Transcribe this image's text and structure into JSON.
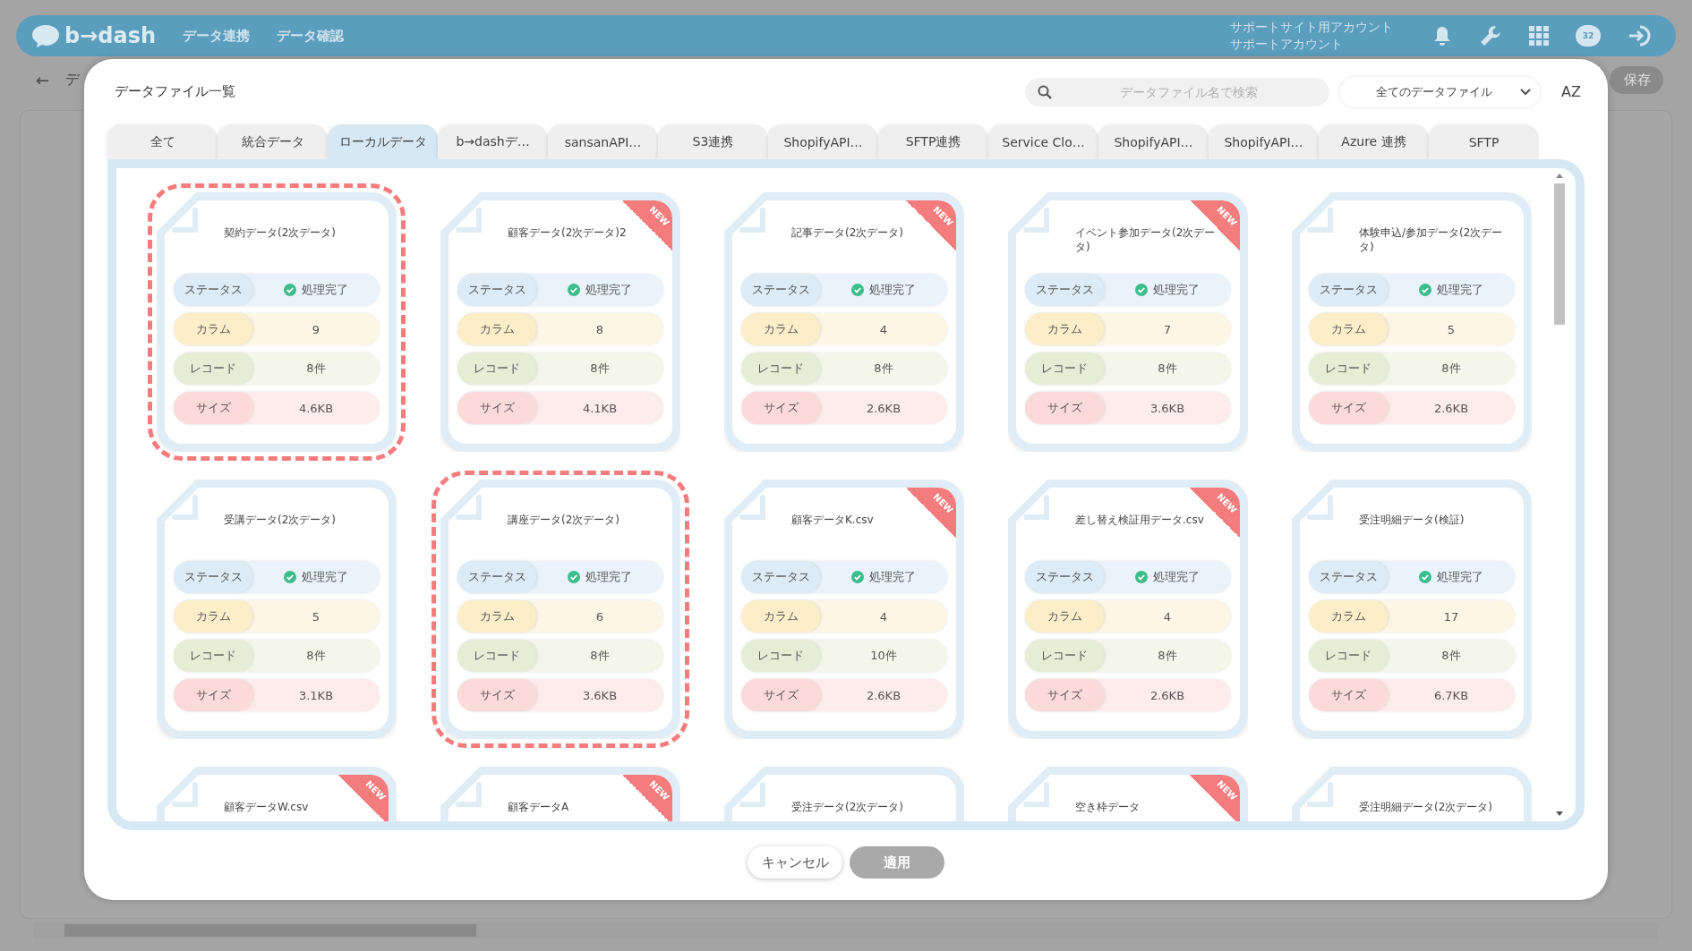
{
  "header": {
    "logo": "b→dash",
    "nav": [
      "データ連携",
      "データ確認"
    ],
    "account": [
      "サポートサイト用アカウント",
      "サポートアカウント"
    ],
    "chat_badge": "32"
  },
  "subbar": {
    "back": "←",
    "breadcrumb": "デ",
    "save": "保存"
  },
  "modal": {
    "title": "データファイル一覧",
    "search": {
      "placeholder": "データファイル名で検索"
    },
    "filter": "全てのデータファイル",
    "sort": "AZ",
    "tabs": [
      {
        "label": "全て",
        "selected": false
      },
      {
        "label": "統合データ",
        "selected": false
      },
      {
        "label": "ローカルデータ",
        "selected": true
      },
      {
        "label": "b→dashデ…",
        "selected": false
      },
      {
        "label": "sansanAPI…",
        "selected": false
      },
      {
        "label": "S3連携",
        "selected": false
      },
      {
        "label": "ShopifyAPI…",
        "selected": false
      },
      {
        "label": "SFTP連携",
        "selected": false
      },
      {
        "label": "Service Clo…",
        "selected": false
      },
      {
        "label": "ShopifyAPI…",
        "selected": false
      },
      {
        "label": "ShopifyAPI…",
        "selected": false
      },
      {
        "label": "Azure 連携",
        "selected": false
      },
      {
        "label": "SFTP",
        "selected": false
      }
    ],
    "cards": [
      {
        "title": "契約データ(2次データ)",
        "selected": true,
        "fields": [
          {
            "kind": "status",
            "label": "ステータス",
            "value": "処理完了"
          },
          {
            "kind": "column",
            "label": "カラム",
            "value": "9"
          },
          {
            "kind": "record",
            "label": "レコード",
            "value": "8件"
          },
          {
            "kind": "size",
            "label": "サイズ",
            "value": "4.6KB"
          }
        ]
      },
      {
        "title": "顧客データ(2次データ)2",
        "badge": "NEW",
        "selected": false,
        "fields": [
          {
            "kind": "status",
            "label": "ステータス",
            "value": "処理完了"
          },
          {
            "kind": "column",
            "label": "カラム",
            "value": "8"
          },
          {
            "kind": "record",
            "label": "レコード",
            "value": "8件"
          },
          {
            "kind": "size",
            "label": "サイズ",
            "value": "4.1KB"
          }
        ]
      },
      {
        "title": "記事データ(2次データ)",
        "badge": "NEW",
        "selected": false,
        "fields": [
          {
            "kind": "status",
            "label": "ステータス",
            "value": "処理完了"
          },
          {
            "kind": "column",
            "label": "カラム",
            "value": "4"
          },
          {
            "kind": "record",
            "label": "レコード",
            "value": "8件"
          },
          {
            "kind": "size",
            "label": "サイズ",
            "value": "2.6KB"
          }
        ]
      },
      {
        "title": "イベント参加データ(2次データ)",
        "badge": "NEW",
        "selected": false,
        "fields": [
          {
            "kind": "status",
            "label": "ステータス",
            "value": "処理完了"
          },
          {
            "kind": "column",
            "label": "カラム",
            "value": "7"
          },
          {
            "kind": "record",
            "label": "レコード",
            "value": "8件"
          },
          {
            "kind": "size",
            "label": "サイズ",
            "value": "3.6KB"
          }
        ]
      },
      {
        "title": "体験申込/参加データ(2次データ)",
        "selected": false,
        "fields": [
          {
            "kind": "status",
            "label": "ステータス",
            "value": "処理完了"
          },
          {
            "kind": "column",
            "label": "カラム",
            "value": "5"
          },
          {
            "kind": "record",
            "label": "レコード",
            "value": "8件"
          },
          {
            "kind": "size",
            "label": "サイズ",
            "value": "2.6KB"
          }
        ]
      },
      {
        "title": "受講データ(2次データ)",
        "selected": false,
        "fields": [
          {
            "kind": "status",
            "label": "ステータス",
            "value": "処理完了"
          },
          {
            "kind": "column",
            "label": "カラム",
            "value": "5"
          },
          {
            "kind": "record",
            "label": "レコード",
            "value": "8件"
          },
          {
            "kind": "size",
            "label": "サイズ",
            "value": "3.1KB"
          }
        ]
      },
      {
        "title": "講座データ(2次データ)",
        "selected": true,
        "fields": [
          {
            "kind": "status",
            "label": "ステータス",
            "value": "処理完了"
          },
          {
            "kind": "column",
            "label": "カラム",
            "value": "6"
          },
          {
            "kind": "record",
            "label": "レコード",
            "value": "8件"
          },
          {
            "kind": "size",
            "label": "サイズ",
            "value": "3.6KB"
          }
        ]
      },
      {
        "title": "顧客データK.csv",
        "badge": "NEW",
        "selected": false,
        "fields": [
          {
            "kind": "status",
            "label": "ステータス",
            "value": "処理完了"
          },
          {
            "kind": "column",
            "label": "カラム",
            "value": "4"
          },
          {
            "kind": "record",
            "label": "レコード",
            "value": "10件"
          },
          {
            "kind": "size",
            "label": "サイズ",
            "value": "2.6KB"
          }
        ]
      },
      {
        "title": "差し替え検証用データ.csv",
        "badge": "NEW",
        "selected": false,
        "fields": [
          {
            "kind": "status",
            "label": "ステータス",
            "value": "処理完了"
          },
          {
            "kind": "column",
            "label": "カラム",
            "value": "4"
          },
          {
            "kind": "record",
            "label": "レコード",
            "value": "8件"
          },
          {
            "kind": "size",
            "label": "サイズ",
            "value": "2.6KB"
          }
        ]
      },
      {
        "title": "受注明細データ(検証)",
        "selected": false,
        "fields": [
          {
            "kind": "status",
            "label": "ステータス",
            "value": "処理完了"
          },
          {
            "kind": "column",
            "label": "カラム",
            "value": "17"
          },
          {
            "kind": "record",
            "label": "レコード",
            "value": "8件"
          },
          {
            "kind": "size",
            "label": "サイズ",
            "value": "6.7KB"
          }
        ]
      },
      {
        "title": "顧客データW.csv",
        "badge": "NEW",
        "selected": false
      },
      {
        "title": "顧客データA",
        "badge": "NEW",
        "selected": false
      },
      {
        "title": "受注データ(2次データ)",
        "selected": false
      },
      {
        "title": "空き枠データ",
        "badge": "NEW",
        "selected": false
      },
      {
        "title": "受注明細データ(2次データ)",
        "selected": false
      }
    ],
    "buttons": [
      {
        "label": "キャンセル",
        "disabled": false
      },
      {
        "label": "適用",
        "disabled": true
      }
    ]
  }
}
